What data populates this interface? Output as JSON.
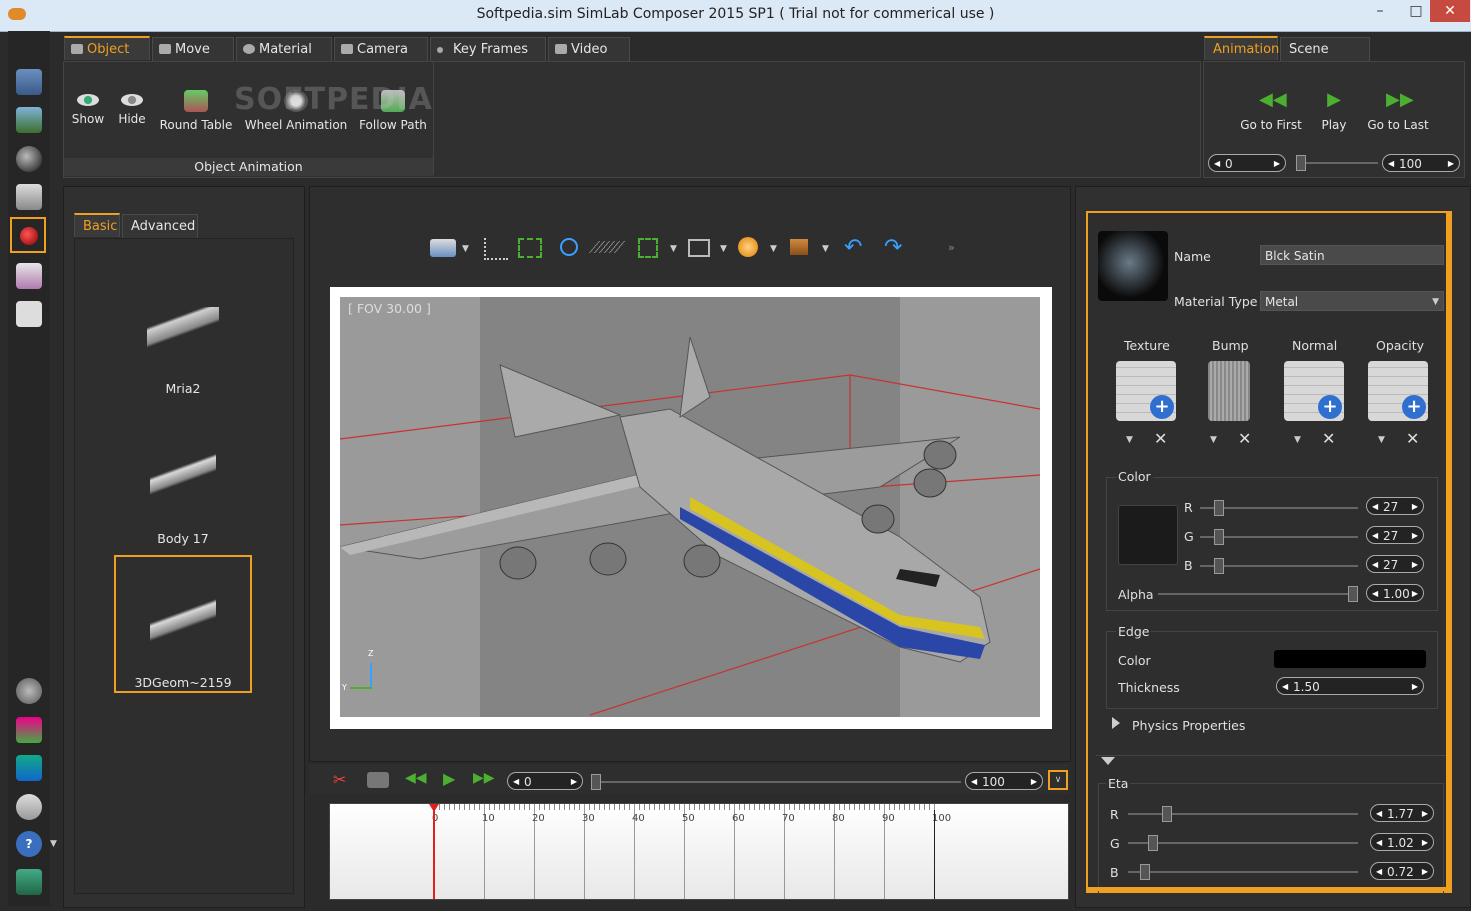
{
  "window": {
    "title": "Softpedia.sim SimLab Composer 2015 SP1 ( Trial not for commerical use )"
  },
  "tabs": [
    {
      "label": "Object",
      "active": true
    },
    {
      "label": "Move",
      "active": false
    },
    {
      "label": "Material",
      "active": false
    },
    {
      "label": "Camera",
      "active": false
    },
    {
      "label": "Key Frames",
      "active": false
    },
    {
      "label": "Video",
      "active": false
    }
  ],
  "ribbon": {
    "buttons": [
      "Show",
      "Hide",
      "Round Table",
      "Wheel Animation",
      "Follow Path"
    ],
    "group_label": "Object Animation",
    "watermark": "SOFTPEDIA"
  },
  "right_tabs": [
    {
      "label": "Animation",
      "active": true
    },
    {
      "label": "Scene States",
      "active": false
    }
  ],
  "animation": {
    "buttons": [
      "Go to First",
      "Play",
      "Go to Last"
    ],
    "start": "0",
    "end": "100"
  },
  "library": {
    "tabs": [
      {
        "label": "Basic",
        "active": true
      },
      {
        "label": "Advanced",
        "active": false
      }
    ],
    "items": [
      "Mria2",
      "Body 17",
      "3DGeom~2159"
    ]
  },
  "viewport": {
    "fov_label": "[ FOV 30.00 ]",
    "axis_z": "Z",
    "axis_y": "Y"
  },
  "timeline": {
    "start": "0",
    "end": "100",
    "ticks": [
      "0",
      "10",
      "20",
      "30",
      "40",
      "50",
      "60",
      "70",
      "80",
      "90",
      "100"
    ]
  },
  "material": {
    "name_label": "Name",
    "name_value": "Blck Satin",
    "type_label": "Material Type",
    "type_value": "Metal",
    "maps": [
      "Texture",
      "Bump",
      "Normal",
      "Opacity"
    ],
    "color_group": "Color",
    "r_label": "R",
    "r": "27",
    "g_label": "G",
    "g": "27",
    "b_label": "B",
    "b": "27",
    "alpha_label": "Alpha",
    "alpha": "1.00",
    "edge_group": "Edge",
    "edge_color_label": "Color",
    "edge_thickness_label": "Thickness",
    "edge_thickness": "1.50",
    "physics_label": "Physics Properties",
    "eta_group": "Eta",
    "eta_r_label": "R",
    "eta_r": "1.77",
    "eta_g_label": "G",
    "eta_g": "1.02",
    "eta_b_label": "B",
    "eta_b": "0.72"
  },
  "colors": {
    "accent": "#f0a020",
    "swatch": "#1b1b1b",
    "edge": "#000000"
  }
}
